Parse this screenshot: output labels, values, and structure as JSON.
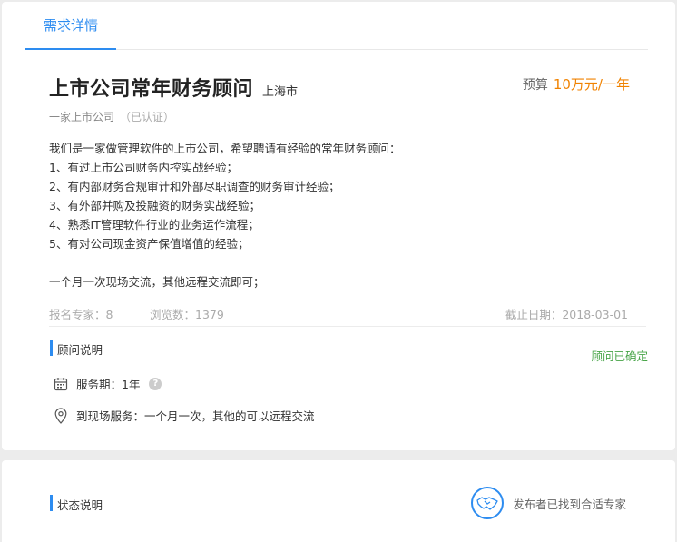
{
  "tabs": {
    "active": "需求详情"
  },
  "header": {
    "title": "上市公司常年财务顾问",
    "city": "上海市",
    "budget_label": "预算",
    "budget_value": "10万元/一年",
    "company": "一家上市公司",
    "certified": "（已认证）"
  },
  "description": {
    "lines": [
      "我们是一家做管理软件的上市公司，希望聘请有经验的常年财务顾问：",
      "1、有过上市公司财务内控实战经验；",
      "2、有内部财务合规审计和外部尽职调查的财务审计经验；",
      "3、有外部并购及投融资的财务实战经验；",
      "4、熟悉IT管理软件行业的业务运作流程；",
      "5、有对公司现金资产保值增值的经验；",
      "",
      "一个月一次现场交流，其他远程交流即可；"
    ]
  },
  "meta": {
    "applicants": "报名专家：8",
    "views": "浏览数：1379",
    "deadline": "截止日期：2018-03-01"
  },
  "consultant": {
    "heading": "顾问说明",
    "status": "顾问已确定",
    "service_period": "服务期：1年",
    "onsite": "到现场服务：一个月一次，其他的可以远程交流"
  },
  "status_section": {
    "heading": "状态说明",
    "message": "发布者已找到合适专家"
  },
  "colors": {
    "accent": "#2d8cf0",
    "budget": "#f08200",
    "success": "#47a447"
  },
  "icons": [
    "calendar-icon",
    "help-icon",
    "location-icon",
    "handshake-icon"
  ]
}
